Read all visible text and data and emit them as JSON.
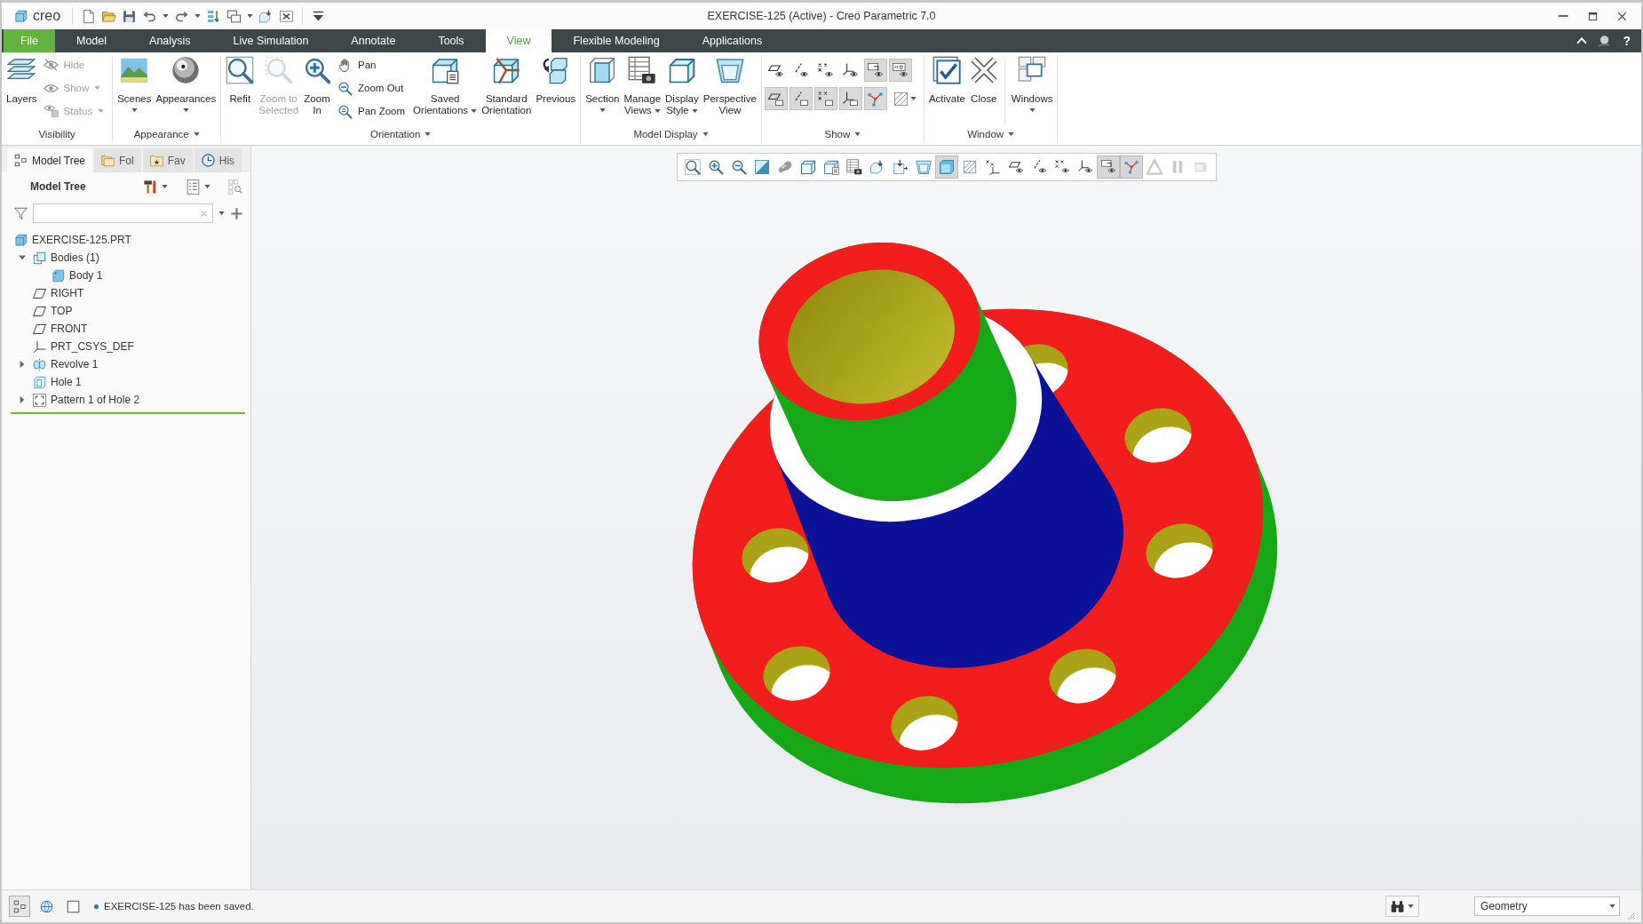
{
  "window": {
    "app_logo": "creo",
    "title": "EXERCISE-125 (Active) - Creo Parametric 7.0"
  },
  "menu_bar": {
    "file": "File",
    "tabs": [
      {
        "label": "Model",
        "selected": false
      },
      {
        "label": "Analysis",
        "selected": false
      },
      {
        "label": "Live Simulation",
        "selected": false
      },
      {
        "label": "Annotate",
        "selected": false
      },
      {
        "label": "Tools",
        "selected": false
      },
      {
        "label": "View",
        "selected": true
      },
      {
        "label": "Flexible Modeling",
        "selected": false
      },
      {
        "label": "Applications",
        "selected": false
      }
    ],
    "help": "?"
  },
  "ribbon": [
    {
      "label": "Visibility",
      "menu": false,
      "items": [
        {
          "kind": "large",
          "lines": [
            "Layers"
          ],
          "menu": false,
          "disabled": false
        },
        {
          "kind": "stack",
          "items": [
            {
              "label": "Hide",
              "menu": false,
              "disabled": true
            },
            {
              "label": "Show",
              "menu": true,
              "disabled": true
            },
            {
              "label": "Status",
              "menu": true,
              "disabled": true
            }
          ]
        }
      ]
    },
    {
      "label": "Appearance",
      "menu": true,
      "items": [
        {
          "kind": "large",
          "lines": [
            "Scenes"
          ],
          "menu": true,
          "disabled": false
        },
        {
          "kind": "large",
          "lines": [
            "Appearances"
          ],
          "menu": true,
          "disabled": false
        }
      ]
    },
    {
      "label": "Orientation",
      "menu": true,
      "items": [
        {
          "kind": "large",
          "lines": [
            "Refit"
          ],
          "menu": false,
          "disabled": false
        },
        {
          "kind": "large",
          "lines": [
            "Zoom to",
            "Selected"
          ],
          "menu": false,
          "disabled": true
        },
        {
          "kind": "large",
          "lines": [
            "Zoom",
            "In"
          ],
          "menu": false,
          "disabled": false
        },
        {
          "kind": "stack",
          "items": [
            {
              "label": "Pan",
              "menu": false,
              "disabled": false
            },
            {
              "label": "Zoom Out",
              "menu": false,
              "disabled": false
            },
            {
              "label": "Pan Zoom",
              "menu": false,
              "disabled": false
            }
          ]
        },
        {
          "kind": "large",
          "lines": [
            "Saved",
            "Orientations"
          ],
          "menu": true,
          "disabled": false
        },
        {
          "kind": "large",
          "lines": [
            "Standard",
            "Orientation"
          ],
          "menu": false,
          "disabled": false
        },
        {
          "kind": "large",
          "lines": [
            "Previous"
          ],
          "menu": false,
          "disabled": false
        }
      ]
    },
    {
      "label": "Model Display",
      "menu": true,
      "items": [
        {
          "kind": "large",
          "lines": [
            "Section"
          ],
          "menu": true,
          "disabled": false
        },
        {
          "kind": "large",
          "lines": [
            "Manage",
            "Views"
          ],
          "menu": true,
          "disabled": false
        },
        {
          "kind": "large",
          "lines": [
            "Display",
            "Style"
          ],
          "menu": true,
          "disabled": false
        },
        {
          "kind": "large",
          "lines": [
            "Perspective",
            "View"
          ],
          "menu": false,
          "disabled": false
        }
      ]
    },
    {
      "label": "Show",
      "menu": true,
      "items": [
        {
          "kind": "grid",
          "rows": [
            [
              {
                "on": false,
                "menu": false
              },
              {
                "on": false,
                "menu": false
              },
              {
                "on": false,
                "menu": false
              },
              {
                "on": false,
                "menu": false
              },
              {
                "on": true,
                "menu": false
              },
              {
                "on": true,
                "menu": false
              }
            ],
            [
              {
                "on": true,
                "menu": false
              },
              {
                "on": true,
                "menu": false
              },
              {
                "on": true,
                "menu": false
              },
              {
                "on": true,
                "menu": false
              },
              {
                "on": true,
                "menu": false
              },
              {
                "on": false,
                "menu": true
              }
            ]
          ]
        }
      ]
    },
    {
      "label": "Window",
      "menu": true,
      "items": [
        {
          "kind": "large",
          "lines": [
            "Activate"
          ],
          "menu": false,
          "disabled": false
        },
        {
          "kind": "large",
          "lines": [
            "Close"
          ],
          "menu": false,
          "disabled": false
        },
        {
          "kind": "separator"
        },
        {
          "kind": "large",
          "lines": [
            "Windows"
          ],
          "menu": true,
          "disabled": false
        }
      ]
    }
  ],
  "panel_tabs": [
    {
      "label": "Model Tree",
      "selected": true
    },
    {
      "label": "Fol",
      "selected": false
    },
    {
      "label": "Fav",
      "selected": false
    },
    {
      "label": "His",
      "selected": false
    }
  ],
  "model_tree": {
    "title": "Model Tree",
    "items": [
      {
        "label": "EXERCISE-125.PRT",
        "kind": "part",
        "children": [
          {
            "label": "Bodies (1)",
            "kind": "bodies",
            "expanded": true,
            "children": [
              {
                "label": "Body 1",
                "kind": "body"
              }
            ]
          },
          {
            "label": "RIGHT",
            "kind": "plane"
          },
          {
            "label": "TOP",
            "kind": "plane"
          },
          {
            "label": "FRONT",
            "kind": "plane"
          },
          {
            "label": "PRT_CSYS_DEF",
            "kind": "csys"
          },
          {
            "label": "Revolve 1",
            "kind": "revolve",
            "expanded": false
          },
          {
            "label": "Hole 1",
            "kind": "hole"
          },
          {
            "label": "Pattern 1 of Hole 2",
            "kind": "pattern",
            "expanded": false
          }
        ]
      }
    ]
  },
  "graphics_toolbar": [
    {
      "on": false,
      "disabled": false
    },
    {
      "on": false,
      "disabled": false
    },
    {
      "on": false,
      "disabled": false
    },
    {
      "on": false,
      "disabled": false
    },
    {
      "on": false,
      "disabled": false
    },
    {
      "on": false,
      "disabled": false
    },
    {
      "on": false,
      "disabled": false
    },
    {
      "on": false,
      "disabled": false
    },
    {
      "on": false,
      "disabled": false
    },
    {
      "on": false,
      "disabled": false
    },
    {
      "on": false,
      "disabled": false
    },
    {
      "on": true,
      "disabled": false
    },
    {
      "on": false,
      "disabled": false
    },
    {
      "on": false,
      "disabled": false
    },
    {
      "on": false,
      "disabled": false
    },
    {
      "on": false,
      "disabled": false
    },
    {
      "on": false,
      "disabled": false
    },
    {
      "on": false,
      "disabled": false
    },
    {
      "on": true,
      "disabled": false
    },
    {
      "on": true,
      "disabled": false
    },
    {
      "on": false,
      "disabled": true
    },
    {
      "on": false,
      "disabled": true
    },
    {
      "on": false,
      "disabled": true
    }
  ],
  "status_bar": {
    "tools": [
      {
        "on": true
      },
      {
        "on": false
      },
      {
        "on": false
      }
    ],
    "message": "EXERCISE-125 has been saved.",
    "selection_filter": "Geometry"
  }
}
